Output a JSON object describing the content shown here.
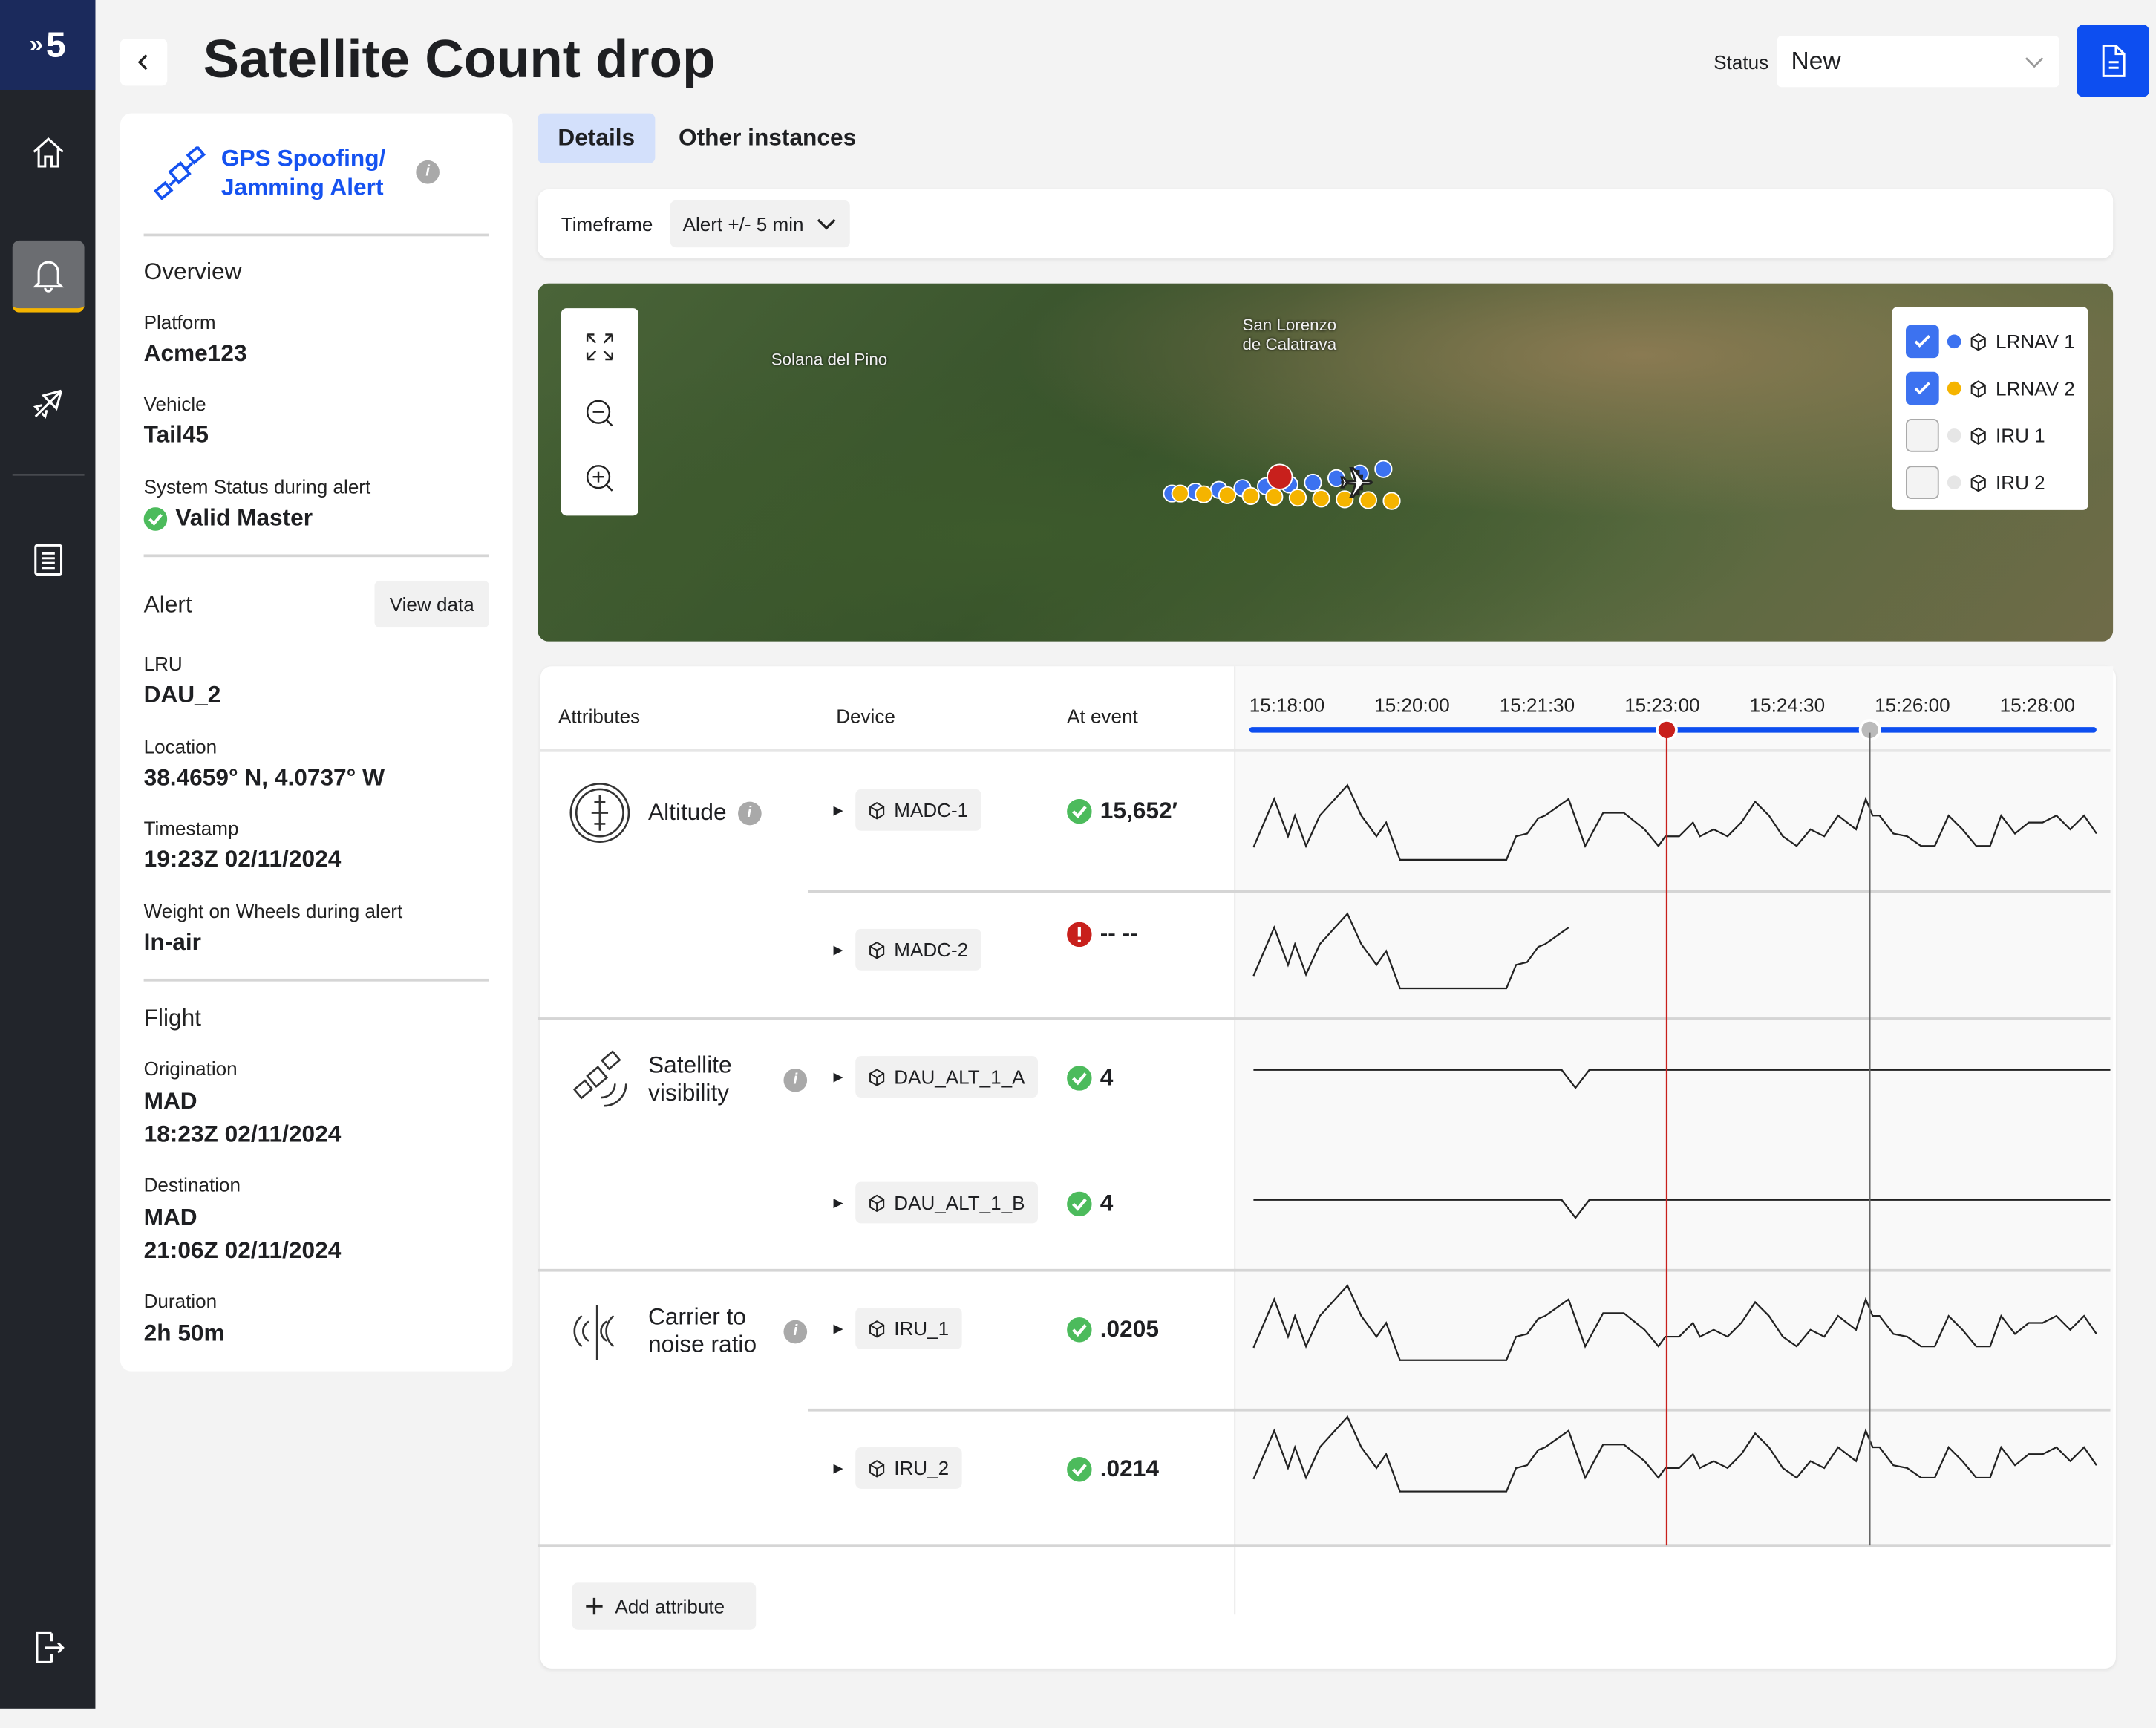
{
  "app": {
    "logo": "5"
  },
  "sidebar": {
    "items": [
      {
        "name": "home",
        "icon": "home-icon"
      },
      {
        "name": "alerts",
        "icon": "bell-icon",
        "active": true
      },
      {
        "name": "flights",
        "icon": "airplane-icon"
      },
      {
        "name": "reports",
        "icon": "list-icon"
      },
      {
        "name": "logout",
        "icon": "logout-icon"
      }
    ]
  },
  "header": {
    "title": "Satellite Count drop",
    "status_label": "Status",
    "status_value": "New"
  },
  "left": {
    "alert_type": "GPS Spoofing/ Jamming Alert",
    "overview": {
      "title": "Overview",
      "fields": [
        {
          "label": "Platform",
          "value": "Acme123"
        },
        {
          "label": "Vehicle",
          "value": "Tail45"
        },
        {
          "label": "System Status during alert",
          "value": "Valid Master"
        }
      ]
    },
    "alert": {
      "title": "Alert",
      "view_data": "View data",
      "fields": [
        {
          "label": "LRU",
          "value": "DAU_2"
        },
        {
          "label": "Location",
          "value": "38.4659° N, 4.0737° W"
        },
        {
          "label": "Timestamp",
          "value": "19:23Z 02/11/2024"
        },
        {
          "label": "Weight on Wheels during alert",
          "value": "In-air"
        }
      ]
    },
    "flight": {
      "title": "Flight",
      "fields": [
        {
          "label": "Origination",
          "value": "MAD",
          "value2": "18:23Z 02/11/2024"
        },
        {
          "label": "Destination",
          "value": "MAD",
          "value2": "21:06Z 02/11/2024"
        },
        {
          "label": "Duration",
          "value": "2h 50m"
        }
      ]
    }
  },
  "tabs": [
    {
      "label": "Details",
      "active": true
    },
    {
      "label": "Other instances"
    }
  ],
  "timeframe": {
    "label": "Timeframe",
    "value": "Alert +/- 5 min"
  },
  "map": {
    "places": [
      "Solana del Pino",
      "San Lorenzo de Calatrava"
    ],
    "legend": [
      {
        "label": "LRNAV 1",
        "checked": true,
        "color": "#3c72f0"
      },
      {
        "label": "LRNAV 2",
        "checked": true,
        "color": "#f5b400"
      },
      {
        "label": "IRU 1",
        "checked": false,
        "color": "#e6e6e6"
      },
      {
        "label": "IRU 2",
        "checked": false,
        "color": "#e6e6e6"
      }
    ]
  },
  "table": {
    "headers": {
      "attributes": "Attributes",
      "device": "Device",
      "at_event": "At event"
    },
    "ticks": [
      "15:18:00",
      "15:20:00",
      "15:21:30",
      "15:23:00",
      "15:24:30",
      "15:26:00",
      "15:28:00"
    ],
    "alert_marker_color": "#c8201c",
    "groups": [
      {
        "name": "Altitude",
        "rows": [
          {
            "device": "MADC-1",
            "status": "ok",
            "value": "15,652′"
          },
          {
            "device": "MADC-2",
            "status": "error",
            "value": "-- --"
          }
        ]
      },
      {
        "name": "Satellite visibility",
        "rows": [
          {
            "device": "DAU_ALT_1_A",
            "status": "ok",
            "value": "4"
          },
          {
            "device": "DAU_ALT_1_B",
            "status": "ok",
            "value": "4"
          }
        ]
      },
      {
        "name": "Carrier to noise ratio",
        "rows": [
          {
            "device": "IRU_1",
            "status": "ok",
            "value": ".0205"
          },
          {
            "device": "IRU_2",
            "status": "ok",
            "value": ".0214"
          }
        ]
      }
    ],
    "add_attribute": "Add attribute"
  },
  "traces": {
    "wave": [
      [
        0,
        9
      ],
      [
        1.5,
        44
      ],
      [
        2.5,
        17
      ],
      [
        3,
        32
      ],
      [
        3.8,
        10
      ],
      [
        4.8,
        32
      ],
      [
        6.8,
        54
      ],
      [
        7.8,
        32
      ],
      [
        8.9,
        17
      ],
      [
        9.6,
        27
      ],
      [
        10.6,
        0
      ],
      [
        18.3,
        0
      ],
      [
        19,
        17
      ],
      [
        19.8,
        19
      ],
      [
        20.6,
        30
      ],
      [
        21.1,
        32
      ],
      [
        22.8,
        44
      ],
      [
        24,
        10
      ],
      [
        25.3,
        34
      ],
      [
        26.8,
        34
      ],
      [
        28.3,
        22
      ],
      [
        29.3,
        10
      ],
      [
        29.8,
        17
      ],
      [
        30.8,
        17
      ],
      [
        31.8,
        27
      ],
      [
        32.3,
        17
      ],
      [
        33.3,
        22
      ],
      [
        34.3,
        17
      ],
      [
        35.3,
        27
      ],
      [
        36.3,
        42
      ],
      [
        37.3,
        32
      ],
      [
        38.3,
        17
      ],
      [
        39.3,
        10
      ],
      [
        40.3,
        22
      ],
      [
        41.3,
        17
      ],
      [
        42.3,
        32
      ],
      [
        43.6,
        22
      ],
      [
        44.3,
        44
      ],
      [
        44.8,
        32
      ],
      [
        45.3,
        32
      ],
      [
        46.3,
        19
      ],
      [
        47.3,
        17
      ],
      [
        48.3,
        10
      ],
      [
        49.3,
        10
      ],
      [
        50.3,
        32
      ],
      [
        51.3,
        22
      ],
      [
        52.3,
        10
      ],
      [
        53.3,
        10
      ],
      [
        54.1,
        32
      ],
      [
        55.1,
        19
      ],
      [
        56.1,
        27
      ],
      [
        57.1,
        27
      ],
      [
        58.1,
        32
      ],
      [
        59.1,
        22
      ],
      [
        60.1,
        32
      ],
      [
        61,
        19
      ]
    ],
    "wave_truncated_at": 23.1,
    "satellites": [
      [
        0,
        4
      ],
      [
        22.3,
        4
      ],
      [
        23.3,
        3
      ],
      [
        24.3,
        4
      ],
      [
        62,
        4
      ]
    ]
  }
}
